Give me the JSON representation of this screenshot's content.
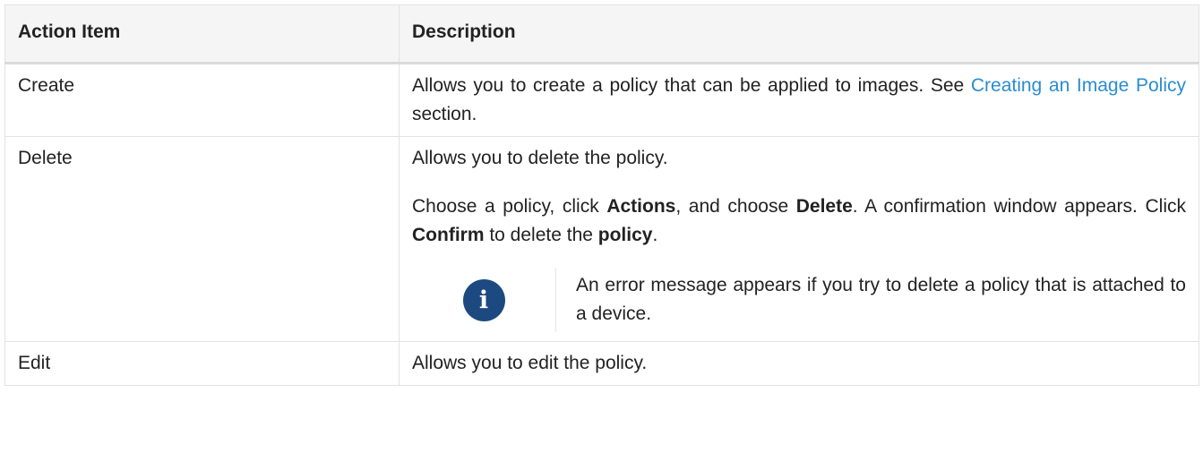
{
  "table": {
    "headers": [
      "Action Item",
      "Description"
    ],
    "rows": {
      "create": {
        "action": "Create",
        "desc_before": "Allows you to create a policy that can be applied to images. See ",
        "desc_link": "Creating an Image Policy",
        "desc_after": " section."
      },
      "delete": {
        "action": "Delete",
        "desc_p1": "Allows you to delete the policy.",
        "p2_t1": "Choose a policy, click ",
        "p2_b1": "Actions",
        "p2_t2": ", and choose ",
        "p2_b2": "Delete",
        "p2_t3": ". A confirmation window appears. Click ",
        "p2_b3": "Confirm",
        "p2_t4": " to delete the ",
        "p2_b4": "policy",
        "p2_t5": ".",
        "note": {
          "icon": "info-icon",
          "icon_glyph": "i",
          "text": "An error message appears if you try to delete a policy that is attached to a device."
        }
      },
      "edit": {
        "action": "Edit",
        "desc": "Allows you to edit the policy."
      }
    }
  },
  "colors": {
    "link": "#2b8ccf",
    "note_icon_bg": "#1c4a80",
    "header_bg": "#f5f5f5",
    "border": "#e2e2e2"
  }
}
